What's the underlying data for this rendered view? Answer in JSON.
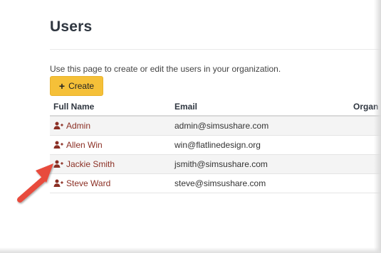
{
  "page": {
    "title": "Users",
    "intro": "Use this page to create or edit the users in your organization."
  },
  "toolbar": {
    "create_label": "Create",
    "create_icon": "plus-icon"
  },
  "table": {
    "headers": {
      "full_name": "Full Name",
      "email": "Email",
      "organization": "Organ"
    },
    "rows": [
      {
        "name": "Admin",
        "email": "admin@simsushare.com",
        "icon": "user-plus-icon"
      },
      {
        "name": "Allen Win",
        "email": "win@flatlinedesign.org",
        "icon": "user-plus-icon"
      },
      {
        "name": "Jackie Smith",
        "email": "jsmith@simsushare.com",
        "icon": "user-plus-icon"
      },
      {
        "name": "Steve Ward",
        "email": "steve@simsushare.com",
        "icon": "user-plus-icon"
      }
    ]
  },
  "annotation": {
    "arrow_color": "#e84c3d",
    "points_to": "Jackie Smith"
  },
  "colors": {
    "accent_button": "#f5c038",
    "link_name": "#8b2f24",
    "title_text": "#2f3640"
  }
}
